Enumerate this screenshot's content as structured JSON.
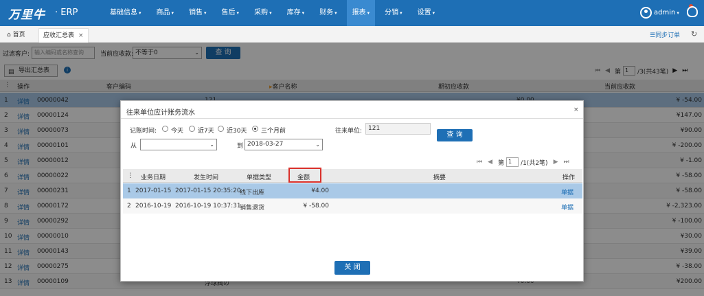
{
  "app": {
    "logo": "万里牛",
    "product": "· ERP"
  },
  "nav": [
    {
      "label": "基础信息",
      "active": false
    },
    {
      "label": "商品",
      "active": false
    },
    {
      "label": "销售",
      "active": false
    },
    {
      "label": "售后",
      "active": false
    },
    {
      "label": "采购",
      "active": false
    },
    {
      "label": "库存",
      "active": false
    },
    {
      "label": "财务",
      "active": false
    },
    {
      "label": "报表",
      "active": true
    },
    {
      "label": "分销",
      "active": false
    },
    {
      "label": "设置",
      "active": false
    }
  ],
  "user": {
    "name": "admin"
  },
  "tabs": {
    "home": "首页",
    "active": "应收汇总表",
    "close": "×",
    "sync": "☰同步订单"
  },
  "filter": {
    "customer_label": "过滤客户:",
    "customer_placeholder": "输入编码或名称查询",
    "current_label": "当前应收款:",
    "current_value": "不等于0",
    "query": "查 询"
  },
  "toolbar": {
    "export": "导出汇总表"
  },
  "pager": {
    "page_label": "第",
    "page": "1",
    "total": "/3(共43笔)"
  },
  "table": {
    "headers": [
      "操作",
      "客户编码",
      "客户名称",
      "期初应收款",
      "当前应收款"
    ],
    "rows": [
      {
        "n": "1",
        "action": "详情",
        "code": "00000042",
        "name": "121",
        "opening": "¥0.00",
        "current": "¥ -54.00"
      },
      {
        "n": "2",
        "action": "详情",
        "code": "00000124",
        "name": "",
        "opening": "",
        "current": "¥147.00"
      },
      {
        "n": "3",
        "action": "详情",
        "code": "00000073",
        "name": "",
        "opening": "",
        "current": "¥90.00"
      },
      {
        "n": "4",
        "action": "详情",
        "code": "00000101",
        "name": "",
        "opening": "",
        "current": "¥ -200.00"
      },
      {
        "n": "5",
        "action": "详情",
        "code": "00000012",
        "name": "",
        "opening": "",
        "current": "¥ -1.00"
      },
      {
        "n": "6",
        "action": "详情",
        "code": "00000022",
        "name": "",
        "opening": "",
        "current": "¥ -58.00"
      },
      {
        "n": "7",
        "action": "详情",
        "code": "00000231",
        "name": "",
        "opening": "",
        "current": "¥ -58.00"
      },
      {
        "n": "8",
        "action": "详情",
        "code": "00000172",
        "name": "",
        "opening": "",
        "current": "¥ -2,323.00"
      },
      {
        "n": "9",
        "action": "详情",
        "code": "00000292",
        "name": "",
        "opening": "",
        "current": "¥ -100.00"
      },
      {
        "n": "10",
        "action": "详情",
        "code": "00000010",
        "name": "",
        "opening": "",
        "current": "¥30.00"
      },
      {
        "n": "11",
        "action": "详情",
        "code": "00000143",
        "name": "",
        "opening": "",
        "current": "¥39.00"
      },
      {
        "n": "12",
        "action": "详情",
        "code": "00000275",
        "name": "",
        "opening": "",
        "current": "¥ -38.00"
      },
      {
        "n": "13",
        "action": "详情",
        "code": "00000109",
        "name": "浮球阀の",
        "opening": "¥0.00",
        "current": "¥200.00"
      }
    ]
  },
  "modal": {
    "title": "往来单位应计账务流水",
    "close": "×",
    "time_label": "记账时间:",
    "radios": [
      {
        "label": "今天",
        "checked": false
      },
      {
        "label": "近7天",
        "checked": false
      },
      {
        "label": "近30天",
        "checked": false
      },
      {
        "label": "三个月前",
        "checked": true
      }
    ],
    "from_label": "从",
    "from_value": "",
    "to_label": "到",
    "to_value": "2018-03-27",
    "unit_label": "往来单位:",
    "unit_value": "121",
    "query": "查 询",
    "pager": {
      "page_label": "第",
      "page": "1",
      "total": "/1(共2笔)"
    },
    "headers": [
      "业务日期",
      "发生时间",
      "单据类型",
      "金额",
      "摘要",
      "操作"
    ],
    "rows": [
      {
        "n": "1",
        "date": "2017-01-15",
        "time": "2017-01-15 20:35:20",
        "type": "线下出库",
        "amount": "¥4.00",
        "summary": "",
        "action": "单据"
      },
      {
        "n": "2",
        "date": "2016-10-19",
        "time": "2016-10-19 10:37:31",
        "type": "销售退货",
        "amount": "¥ -58.00",
        "summary": "",
        "action": "单据"
      }
    ],
    "close_button": "关 闭"
  }
}
